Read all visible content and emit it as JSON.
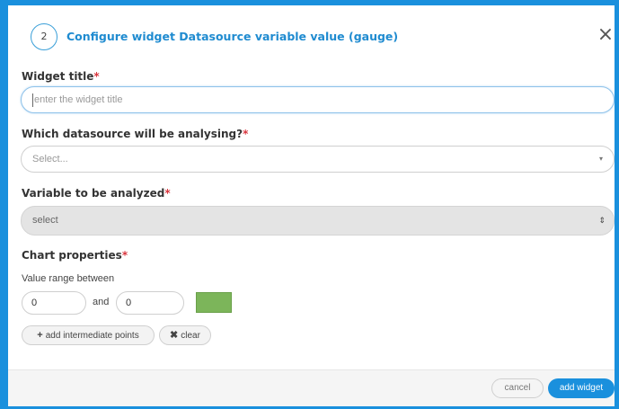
{
  "dialog": {
    "step_number": "2",
    "title": "Configure widget Datasource variable value (gauge)",
    "close_symbol": "×",
    "accent_color": "#1a90dd"
  },
  "form": {
    "widget_title": {
      "label": "Widget title",
      "required_mark": "*",
      "placeholder": "enter the widget title",
      "value": ""
    },
    "datasource": {
      "label": "Which datasource will be analysing?",
      "required_mark": "*",
      "selected": "Select...",
      "arrow": "▾"
    },
    "variable": {
      "label": "Variable to be analyzed",
      "required_mark": "*",
      "selected": "select",
      "arrow": "⇕"
    },
    "chart_properties": {
      "label": "Chart properties",
      "required_mark": "*",
      "range_label": "Value range between",
      "min_value": "0",
      "and_text": "and",
      "max_value": "0",
      "color": "#7cb55a"
    },
    "add_points_button": {
      "icon": "+",
      "label": "add intermediate points"
    },
    "clear_button": {
      "icon": "✖",
      "label": "clear"
    }
  },
  "footer": {
    "cancel_label": "cancel",
    "submit_label": "add widget"
  }
}
